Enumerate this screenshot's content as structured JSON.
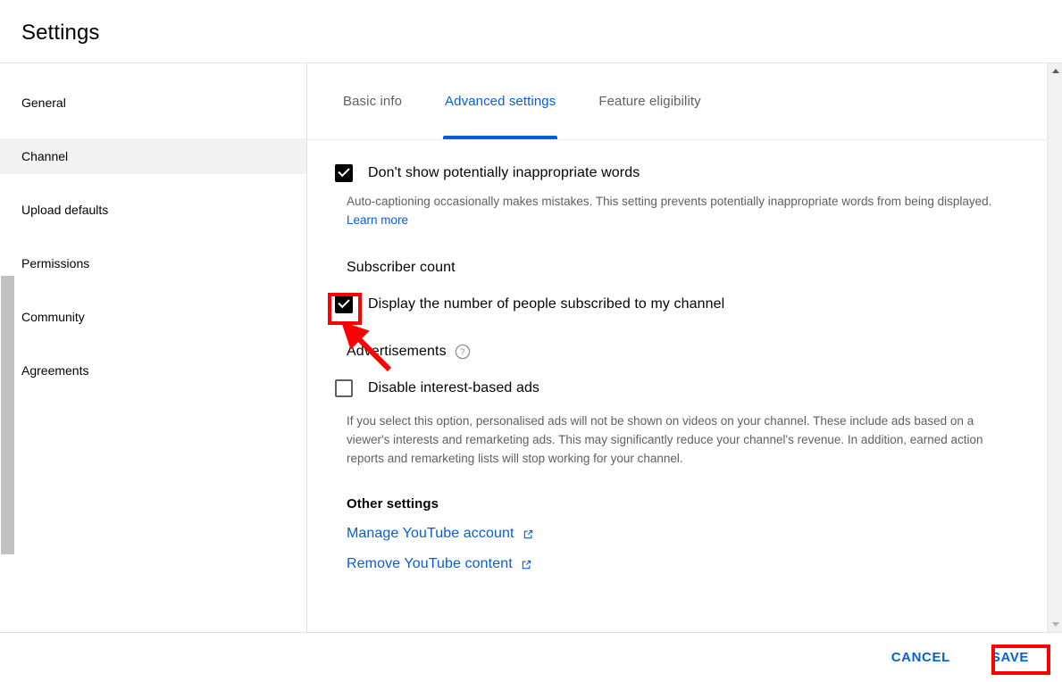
{
  "dialog": {
    "title": "Settings"
  },
  "sidebar": {
    "items": [
      {
        "label": "General",
        "active": false
      },
      {
        "label": "Channel",
        "active": true
      },
      {
        "label": "Upload defaults",
        "active": false
      },
      {
        "label": "Permissions",
        "active": false
      },
      {
        "label": "Community",
        "active": false
      },
      {
        "label": "Agreements",
        "active": false
      }
    ]
  },
  "main": {
    "tabs": [
      {
        "label": "Basic info",
        "active": false
      },
      {
        "label": "Advanced settings",
        "active": true
      },
      {
        "label": "Feature eligibility",
        "active": false
      }
    ],
    "inappropriate_words": {
      "label": "Don't show potentially inappropriate words",
      "checked": true,
      "helper_text": "Auto-captioning occasionally makes mistakes. This setting prevents potentially inappropriate words from being displayed. ",
      "learn_more": "Learn more"
    },
    "subscriber_count": {
      "heading": "Subscriber count",
      "checkbox_label": "Display the number of people subscribed to my channel",
      "checked": true
    },
    "advertisements": {
      "heading": "Advertisements",
      "help_icon": "help-circle-icon",
      "checkbox_label": "Disable interest-based ads",
      "checked": false,
      "helper_text": "If you select this option, personalised ads will not be shown on videos on your channel. These include ads based on a viewer's interests and remarketing ads. This may significantly reduce your channel's revenue. In addition, earned action reports and remarketing lists will stop working for your channel."
    },
    "other_settings": {
      "heading": "Other settings",
      "links": [
        {
          "label": "Manage YouTube account",
          "icon": "external-link-icon"
        },
        {
          "label": "Remove YouTube content",
          "icon": "external-link-icon"
        }
      ]
    }
  },
  "footer": {
    "cancel_label": "CANCEL",
    "save_label": "SAVE"
  },
  "annotations": {
    "highlight_color": "#ff0000",
    "subscriber_checkbox_highlight": true,
    "save_button_highlight": true,
    "arrow_points_to": "subscriber-count-checkbox"
  },
  "colors": {
    "accent_blue": "#065fd4",
    "text_primary": "#030303",
    "text_secondary": "#606060",
    "active_sidebar_bg": "#f2f2f2",
    "highlight_red": "#ff0000"
  },
  "scrollbar": {
    "up_arrow": "triangle-up-icon",
    "down_arrow": "triangle-down-icon"
  }
}
